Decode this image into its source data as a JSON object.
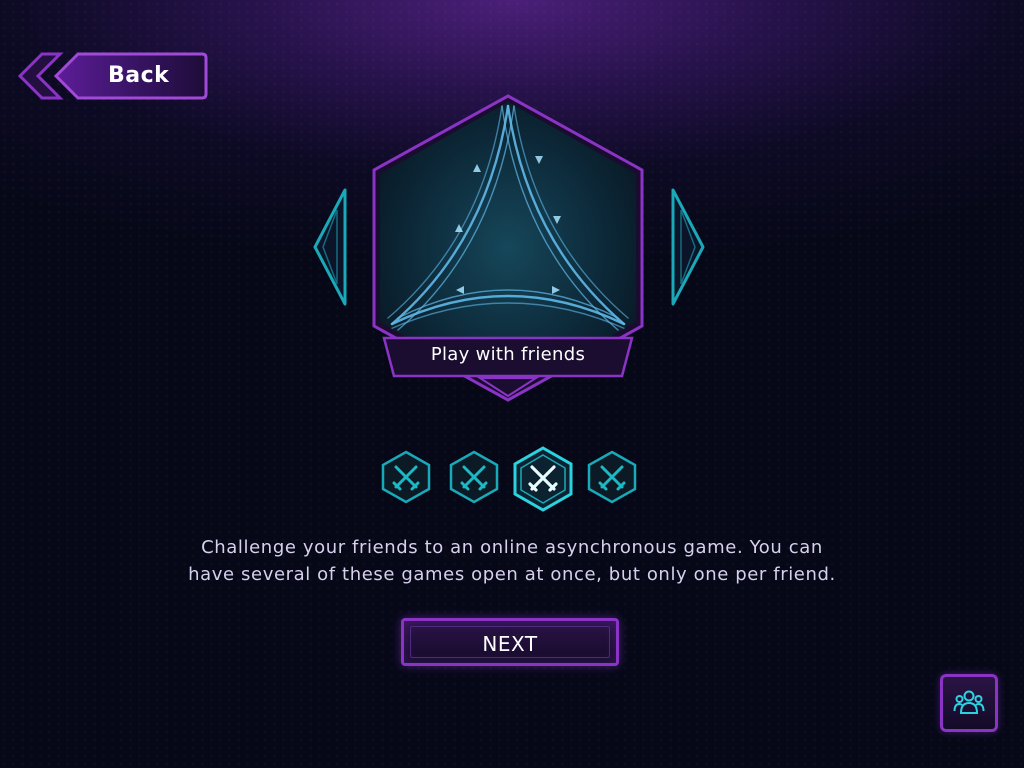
{
  "header": {
    "back_label": "Back"
  },
  "mode": {
    "title": "Play with friends",
    "image_icon": "triangle-arrows-icon",
    "description_line1": "Challenge your friends to an online asynchronous game. You can",
    "description_line2": "have several of these games open at once, but only one per friend."
  },
  "pager": {
    "page_count": 4,
    "active_index": 2,
    "icon": "crossed-swords-icon"
  },
  "actions": {
    "next_label": "NEXT",
    "friends_icon": "friends-icon"
  },
  "colors": {
    "accent_purple": "#8a34c6",
    "accent_cyan": "#1ec5d0",
    "background": "#0d0a24"
  }
}
